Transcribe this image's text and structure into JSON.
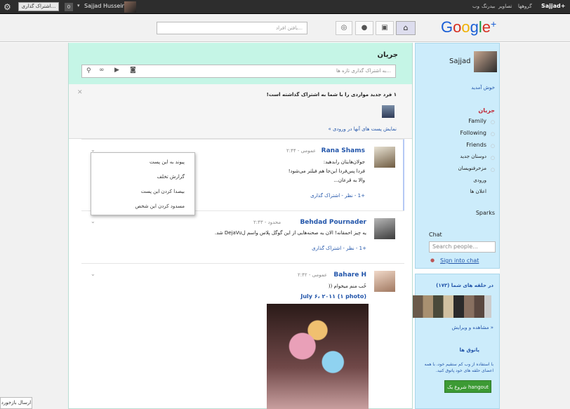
{
  "topbar": {
    "share_button": "اشتراک گذاری...",
    "count": "0",
    "user_name": "Sajjad Husseini",
    "nav_brand": "Sajjad+",
    "nav_items": [
      "گروهها",
      "تصاویر",
      "بیدرنگ",
      "وب"
    ]
  },
  "header": {
    "search_placeholder": "یافتن افراد...",
    "logo": "Google+"
  },
  "stream": {
    "title": "جریان",
    "share_placeholder": "به اشتراک گذاری تازه ها...",
    "new_items_notice": "۱ فرد جدید مواردی را با شما به اشتراک گذاشته است!",
    "show_posts_link": "نمایش پست های آنها در ورودی »"
  },
  "posts": [
    {
      "author": "Rana Shams",
      "meta": "۲:۴۴ - عمومی",
      "lines": [
        "جولان‌هایتان رابدهید:",
        "فردا پس‌فردا این‌جا هم فیلتر می‌شود!",
        "والا به قرعان..."
      ],
      "actions": "+1 - نظر - اشتراک گذاری"
    },
    {
      "author": "Behdad Pournader",
      "meta": "۲:۴۳ - محدود",
      "lines": [
        "یه چیز احمقانه! الان یه صحنه‌هایی از این گوگل پلاس واسم لDejaVu شد."
      ],
      "actions": "+1 - نظر - اشتراک گذاری"
    },
    {
      "author": "Bahare H",
      "meta": "۲:۴۲ - عمومی",
      "lines": [
        "خُب منم میخوام ((",
        "July ۶، ۲۰۱۱ (۱ photo)"
      ],
      "actions": ""
    }
  ],
  "post_menu": [
    "پیوند به این پست",
    "گزارش تخلف",
    "بیصدا کردن این پست",
    "مسدود کردن این شخص"
  ],
  "sidebar": {
    "profile_name": "Sajjad",
    "welcome": "خوش آمدید",
    "stream_label": "جریان",
    "circles": [
      "Family",
      "Following",
      "Friends",
      "دوستان جدید",
      "مزخرفنویسان"
    ],
    "incoming": "ورودی",
    "notifications": "اعلان ها",
    "sparks": "Sparks",
    "chat_title": "Chat",
    "chat_search_placeholder": "Search people...",
    "chat_signin": "Sign into chat"
  },
  "sidebar2": {
    "circles_title": "در حلقه های شما (۱۷۳)",
    "view_edit": "مشاهده و ویرایش »",
    "hangout_title": "پاتوق ها",
    "hangout_desc": "با استفاده از وب کم ستقیم خود، با همه اعضای حلقه های خود پاتوق کنید.",
    "hangout_button": "شروع یک hangout"
  },
  "footer": {
    "feedback": "ارسال بازخورد"
  }
}
